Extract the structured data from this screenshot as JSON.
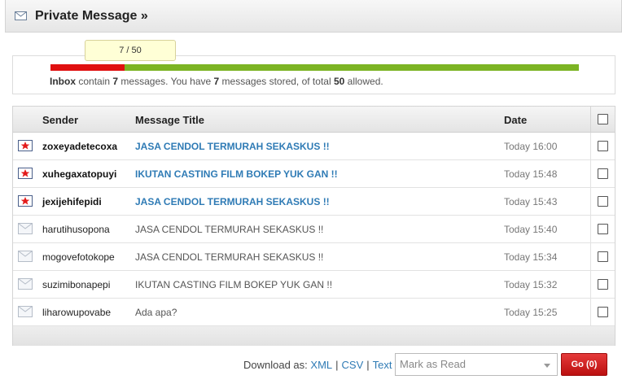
{
  "header": {
    "title": "Private Message »",
    "icon": "envelope-icon"
  },
  "quota": {
    "tooltip": "7 / 50",
    "used": 7,
    "total": 50,
    "used_fraction": 0.14,
    "folder": "Inbox",
    "text_contain": "contain",
    "text_messages": "messages. You have",
    "text_stored": "messages stored, of total",
    "text_allowed": "allowed.",
    "used_label": "7",
    "stored_label": "7",
    "total_label": "50",
    "colors": {
      "used": "#e01010",
      "free": "#7cb424"
    }
  },
  "table": {
    "headers": {
      "sender": "Sender",
      "title": "Message Title",
      "date": "Date"
    },
    "rows": [
      {
        "sender": "zoxeyadetecoxa",
        "title": "JASA CENDOL TERMURAH SEKASKUS !!",
        "date": "Today 16:00",
        "unread": true
      },
      {
        "sender": "xuhegaxatopuyi",
        "title": "IKUTAN CASTING FILM BOKEP YUK GAN !!",
        "date": "Today 15:48",
        "unread": true
      },
      {
        "sender": "jexijehifepidi",
        "title": "JASA CENDOL TERMURAH SEKASKUS !!",
        "date": "Today 15:43",
        "unread": true
      },
      {
        "sender": "harutihusopona",
        "title": "JASA CENDOL TERMURAH SEKASKUS !!",
        "date": "Today 15:40",
        "unread": false
      },
      {
        "sender": "mogovefotokope",
        "title": "JASA CENDOL TERMURAH SEKASKUS !!",
        "date": "Today 15:34",
        "unread": false
      },
      {
        "sender": "suzimibonapepi",
        "title": "IKUTAN CASTING FILM BOKEP YUK GAN !!",
        "date": "Today 15:32",
        "unread": false
      },
      {
        "sender": "liharowupovabe",
        "title": "Ada apa?",
        "date": "Today 15:25",
        "unread": false
      }
    ]
  },
  "footer": {
    "download_label": "Download as:",
    "formats": [
      "XML",
      "CSV",
      "Text"
    ],
    "separator": "|",
    "action_select": "Mark as Read",
    "go_label": "Go (0)"
  }
}
